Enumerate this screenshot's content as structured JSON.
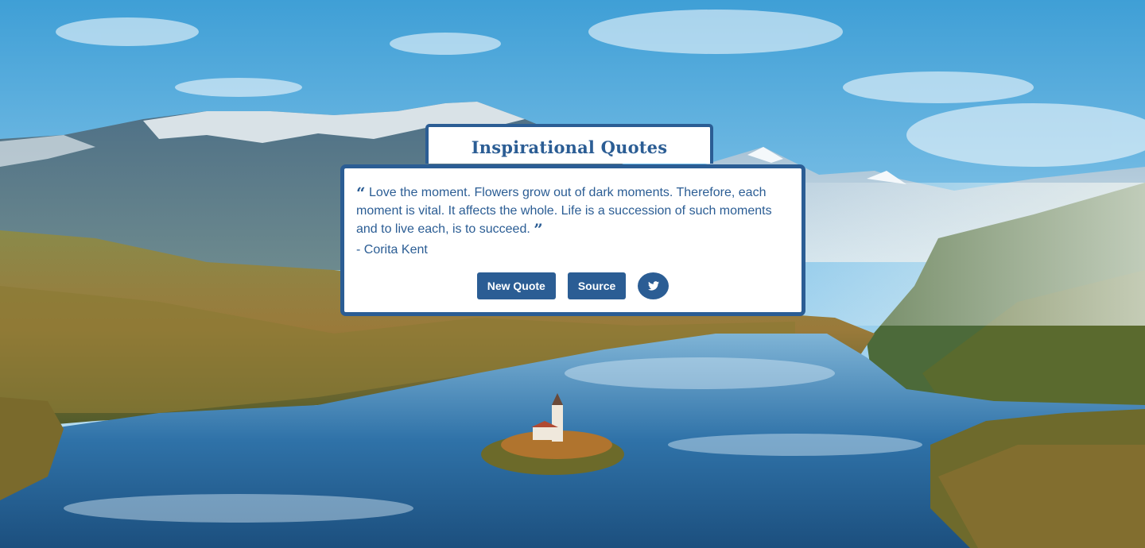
{
  "header": {
    "title": "Inspirational Quotes"
  },
  "quote": {
    "open_mark": "“",
    "text": "Love the moment. Flowers grow out of dark moments. Therefore, each moment is vital. It affects the whole. Life is a succession of such moments and to live each, is to succeed.",
    "close_mark": "”",
    "author": "- Corita Kent"
  },
  "actions": {
    "new_quote_label": "New Quote",
    "source_label": "Source",
    "twitter_icon": "twitter-bird-icon"
  },
  "colors": {
    "accent": "#2b5d94",
    "card_background": "#ffffff"
  },
  "background": {
    "description_icon": "mountain-lake-photo"
  }
}
